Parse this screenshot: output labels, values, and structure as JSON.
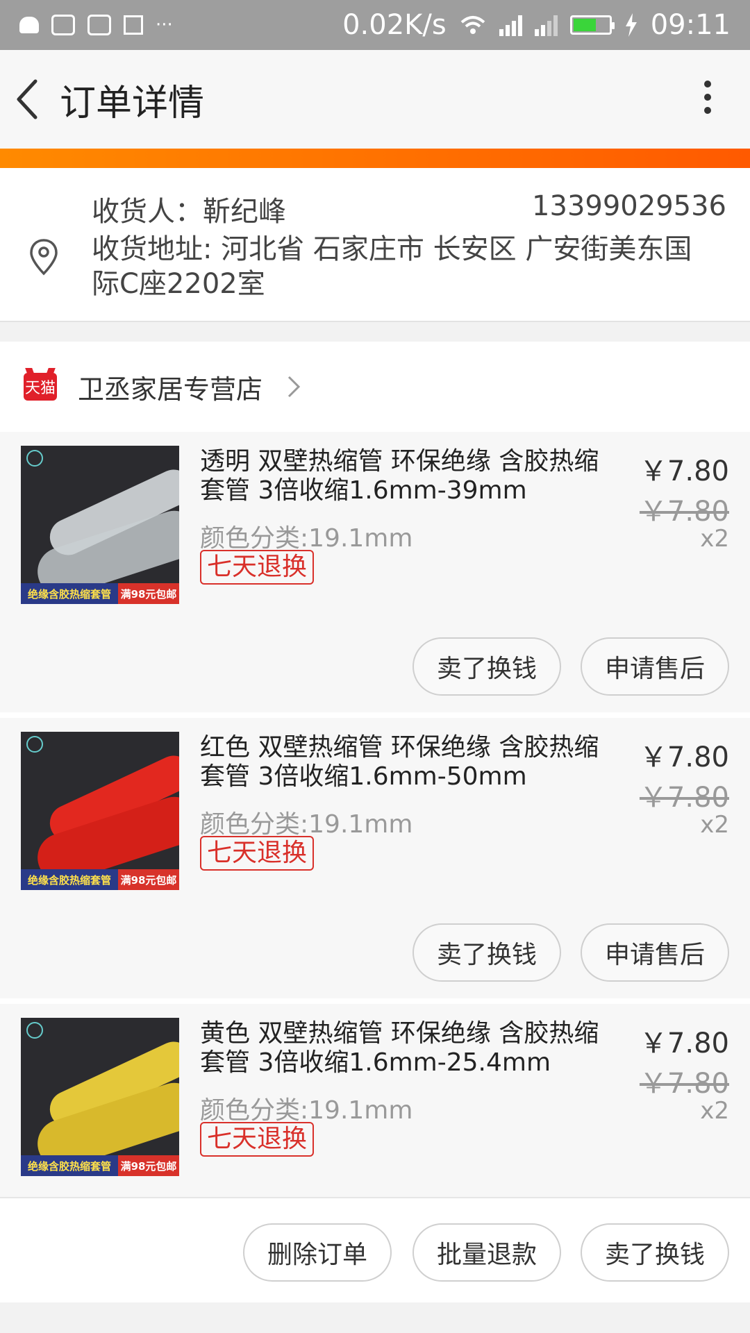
{
  "status_bar": {
    "speed": "0.02K/s",
    "time": "09:11",
    "sim1": "2G",
    "sim2": "4G"
  },
  "header": {
    "title": "订单详情"
  },
  "address": {
    "receiver": "收货人：靳纪峰",
    "phone": "13399029536",
    "address": "收货地址: 河北省 石家庄市 长安区 广安街美东国际C座2202室"
  },
  "store": {
    "badge": "天猫",
    "name": "卫丞家居专营店"
  },
  "items": [
    {
      "title": "透明 双壁热缩管 环保绝缘 含胶热缩套管 3倍收缩1.6mm-39mm",
      "variant": "颜色分类:19.1mm",
      "tag": "七天退换",
      "price": "￥7.80",
      "original_price": "￥7.80",
      "quantity": "x2",
      "banner_left": "绝缘含胶热缩套管",
      "banner_right": "满98元包邮",
      "tube_color": "#dfe4e6",
      "btn_sell": "卖了换钱",
      "btn_service": "申请售后"
    },
    {
      "title": "红色 双壁热缩管 环保绝缘 含胶热缩套管 3倍收缩1.6mm-50mm",
      "variant": "颜色分类:19.1mm",
      "tag": "七天退换",
      "price": "￥7.80",
      "original_price": "￥7.80",
      "quantity": "x2",
      "banner_left": "绝缘含胶热缩套管",
      "banner_right": "满98元包邮",
      "tube_color": "#e2281f",
      "btn_sell": "卖了换钱",
      "btn_service": "申请售后"
    },
    {
      "title": "黄色 双壁热缩管 环保绝缘 含胶热缩套管 3倍收缩1.6mm-25.4mm",
      "variant": "颜色分类:19.1mm",
      "tag": "七天退换",
      "price": "￥7.80",
      "original_price": "￥7.80",
      "quantity": "x2",
      "banner_left": "绝缘含胶热缩套管",
      "banner_right": "满98元包邮",
      "tube_color": "#e4c83a"
    }
  ],
  "bottom_actions": {
    "delete": "删除订单",
    "refund": "批量退款",
    "sell": "卖了换钱"
  }
}
